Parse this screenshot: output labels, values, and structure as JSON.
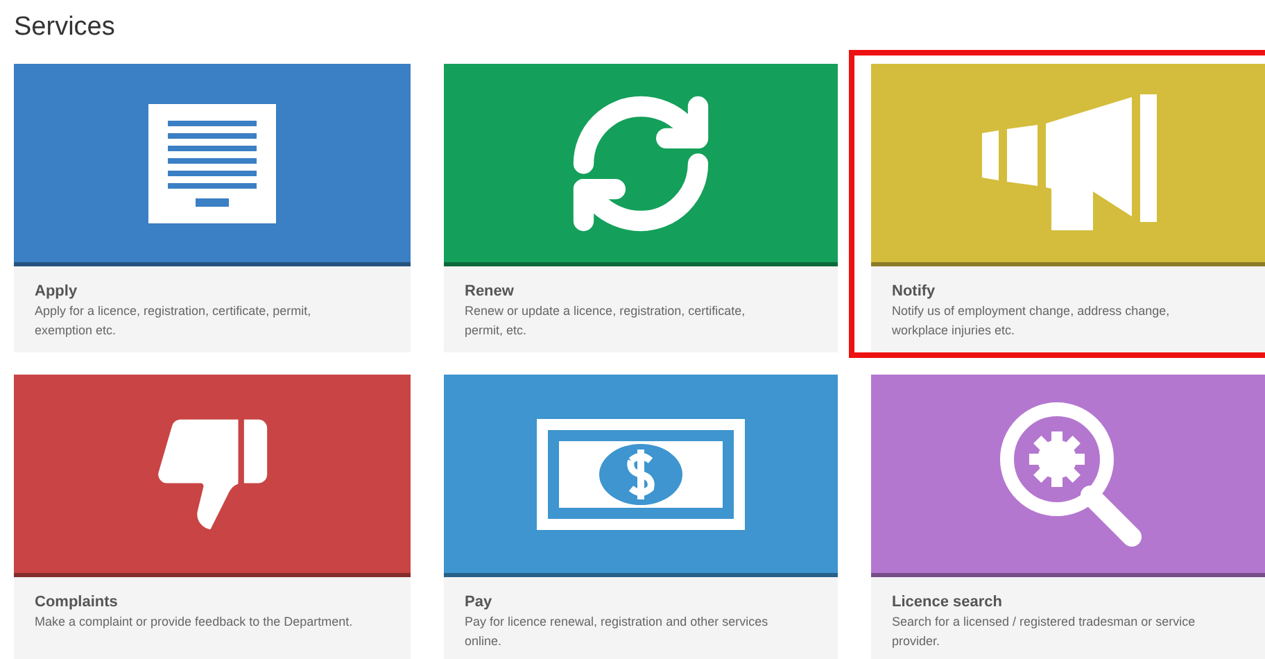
{
  "heading": "Services",
  "services": [
    {
      "title": "Apply",
      "description": "Apply for a licence, registration, certificate, permit, exemption etc.",
      "color": "#3b7fc4",
      "highlighted": false
    },
    {
      "title": "Renew",
      "description": "Renew or update a licence, registration, certificate, permit, etc.",
      "color": "#14a05a",
      "highlighted": false
    },
    {
      "title": "Notify",
      "description": "Notify us of employment change, address change, workplace injuries etc.",
      "color": "#d4bd3c",
      "highlighted": true
    },
    {
      "title": "Complaints",
      "description": "Make a complaint or provide feedback to the Department.",
      "color": "#c94444",
      "highlighted": false
    },
    {
      "title": "Pay",
      "description": "Pay for licence renewal, registration and other services online.",
      "color": "#3e95cf",
      "highlighted": false
    },
    {
      "title": "Licence search",
      "description": "Search for a licensed / registered tradesman or service provider.",
      "color": "#b477cf",
      "highlighted": false
    }
  ]
}
